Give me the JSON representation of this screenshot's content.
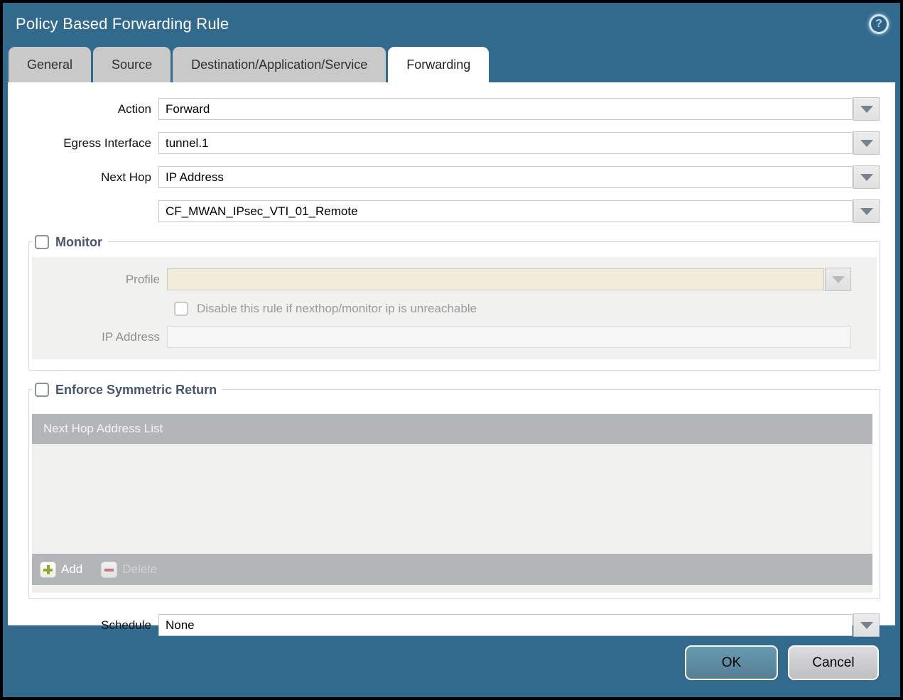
{
  "dialog": {
    "title": "Policy Based Forwarding Rule",
    "help_glyph": "?"
  },
  "tabs": [
    {
      "label": "General",
      "active": false
    },
    {
      "label": "Source",
      "active": false
    },
    {
      "label": "Destination/Application/Service",
      "active": false
    },
    {
      "label": "Forwarding",
      "active": true
    }
  ],
  "form": {
    "action": {
      "label": "Action",
      "value": "Forward"
    },
    "egress_interface": {
      "label": "Egress Interface",
      "value": "tunnel.1"
    },
    "next_hop": {
      "label": "Next Hop",
      "value": "IP Address"
    },
    "next_hop_address": {
      "value": "CF_MWAN_IPsec_VTI_01_Remote"
    },
    "schedule": {
      "label": "Schedule",
      "value": "None"
    }
  },
  "monitor": {
    "legend": "Monitor",
    "checked": false,
    "profile": {
      "label": "Profile",
      "value": ""
    },
    "disable_rule_label": "Disable this rule if nexthop/monitor ip is unreachable",
    "disable_rule_checked": false,
    "ip_address": {
      "label": "IP Address",
      "value": ""
    }
  },
  "enforce_symmetric_return": {
    "legend": "Enforce Symmetric Return",
    "checked": false,
    "table": {
      "header": "Next Hop Address List",
      "rows": []
    },
    "add_label": "Add",
    "delete_label": "Delete",
    "delete_enabled": false
  },
  "footer": {
    "ok_label": "OK",
    "cancel_label": "Cancel"
  },
  "colors": {
    "titlebar_teal": "#316a8d",
    "tab_inactive": "#c9c9c9",
    "tab_active": "#ffffff",
    "table_gray": "#b3b6b8",
    "disabled_beige_field": "#f2ecda",
    "ok_button": "#5d92a8",
    "legend_text": "#47566a",
    "add_plus_green": "#96a433",
    "delete_minus_red": "#c77781"
  }
}
